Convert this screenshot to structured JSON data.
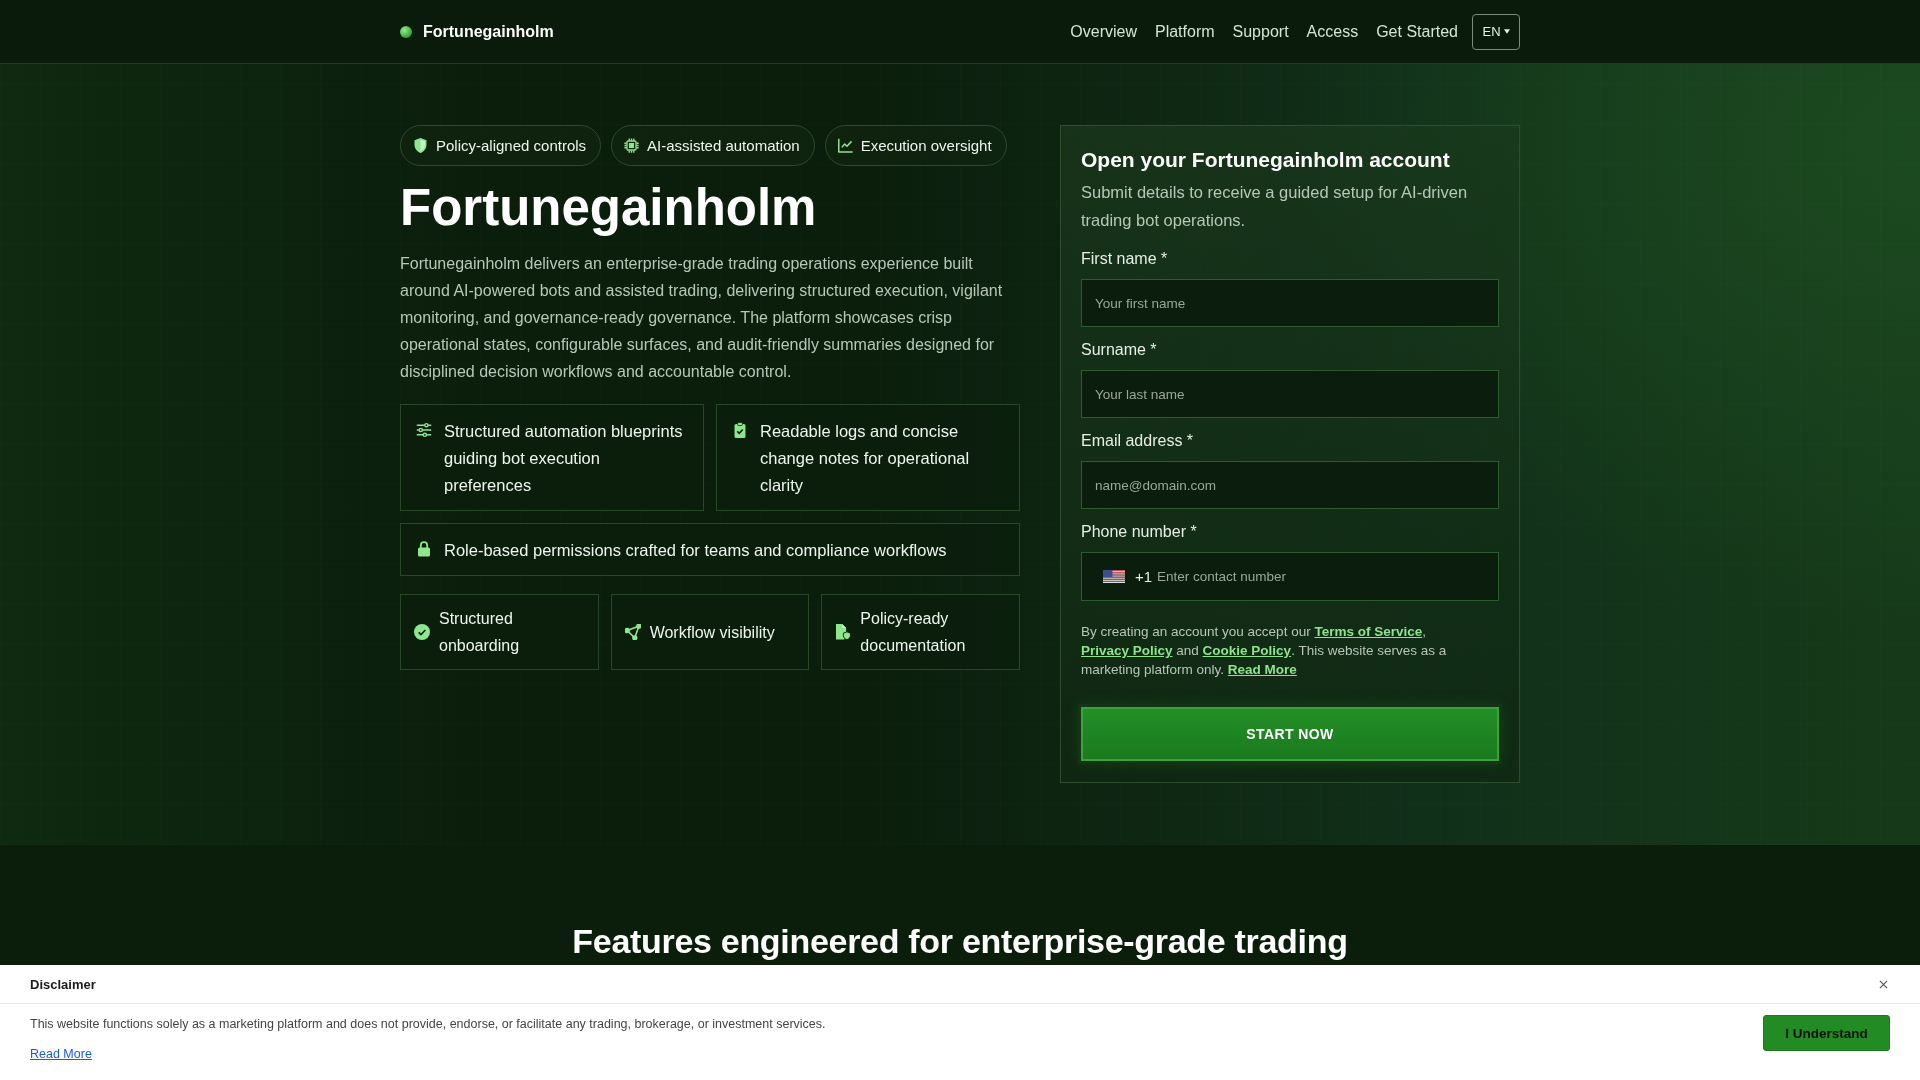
{
  "header": {
    "logo": "Fortunegainholm",
    "nav": [
      "Overview",
      "Platform",
      "Support",
      "Access",
      "Get Started"
    ],
    "language": "EN"
  },
  "hero": {
    "badges": [
      "Policy-aligned controls",
      "AI-assisted automation",
      "Execution oversight"
    ],
    "title": "Fortunegainholm",
    "description": "Fortunegainholm delivers an enterprise-grade trading operations experience built around AI-powered bots and assisted trading, delivering structured execution, vigilant monitoring, and governance-ready governance. The platform showcases crisp operational states, configurable surfaces, and audit-friendly summaries designed for disciplined decision workflows and accountable control.",
    "highlights": [
      "Structured automation blueprints guiding bot execution preferences",
      "Readable logs and concise change notes for operational clarity"
    ],
    "wide_highlight": "Role-based permissions crafted for teams and compliance workflows",
    "benefits": [
      "Structured onboarding",
      "Workflow visibility",
      "Policy-ready documentation"
    ]
  },
  "signup_form": {
    "title": "Open your Fortunegainholm account",
    "subtitle": "Submit details to receive a guided setup for AI-driven trading bot operations.",
    "fields": [
      {
        "label": "First name *",
        "placeholder": "Your first name"
      },
      {
        "label": "Surname *",
        "placeholder": "Your last name"
      },
      {
        "label": "Email address *",
        "placeholder": "name@domain.com"
      }
    ],
    "phone": {
      "label": "Phone number *",
      "dial_code": "+1",
      "placeholder": "Enter contact number"
    },
    "consent": [
      {
        "kind": "text",
        "text": "By creating an account you accept our "
      },
      {
        "kind": "link",
        "text": "Terms of Service"
      },
      {
        "kind": "text",
        "text": ", "
      },
      {
        "kind": "link",
        "text": "Privacy Policy"
      },
      {
        "kind": "text",
        "text": " and "
      },
      {
        "kind": "link",
        "text": "Cookie Policy"
      },
      {
        "kind": "text",
        "text": ". This website serves as a marketing platform only. "
      },
      {
        "kind": "link",
        "text": "Read More"
      }
    ],
    "submit": "START NOW"
  },
  "features": {
    "title": "Features engineered for enterprise-grade trading"
  },
  "disclaimer": {
    "title": "Disclaimer",
    "text": "This website functions solely as a marketing platform and does not provide, endorse, or facilitate any trading, brokerage, or investment services.",
    "link": "Read More",
    "button": "I Understand"
  }
}
